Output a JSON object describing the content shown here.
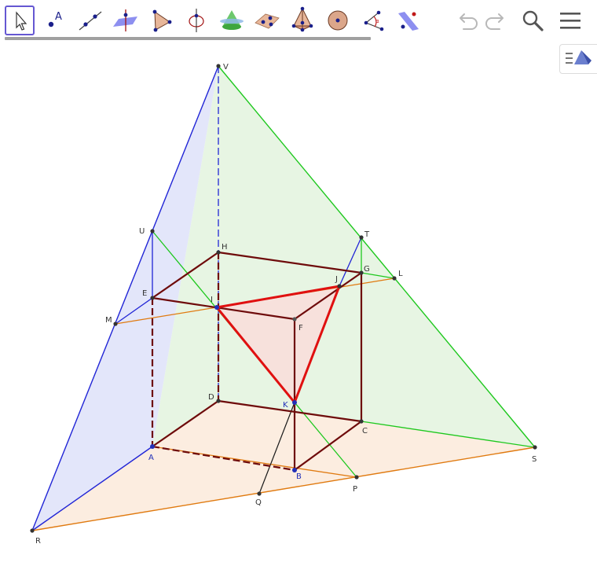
{
  "toolbar": {
    "tools": [
      {
        "name": "Move",
        "icon": "move-arrow-icon"
      },
      {
        "name": "Point",
        "icon": "point-icon",
        "glyph": "A"
      },
      {
        "name": "Line",
        "icon": "line-icon"
      },
      {
        "name": "Perpendicular Line",
        "icon": "perpendicular-line-icon"
      },
      {
        "name": "Polygon",
        "icon": "polygon-icon"
      },
      {
        "name": "Circle with Axis",
        "icon": "circle-axis-icon"
      },
      {
        "name": "Intersect Two Surfaces",
        "icon": "intersect-surfaces-icon"
      },
      {
        "name": "Plane through 3 Points",
        "icon": "plane-three-points-icon"
      },
      {
        "name": "Pyramid",
        "icon": "pyramid-icon"
      },
      {
        "name": "Sphere",
        "icon": "sphere-icon"
      },
      {
        "name": "Angle",
        "icon": "angle-icon"
      },
      {
        "name": "Reflect about Plane",
        "icon": "reflect-plane-icon"
      }
    ],
    "right_icons": [
      "undo-icon",
      "redo-icon",
      "search-icon",
      "menu-icon"
    ]
  },
  "view_toggle": {
    "icon": "graphics-view-toggle-icon"
  },
  "colors": {
    "plane_blue": "#2125d6",
    "plane_green": "#1ec81e",
    "plane_orange": "#e07a10",
    "cube_edges": "#6e0b0b",
    "section_red": "#e01010",
    "point_dark": "#333333",
    "point_blue": "#2130b8"
  },
  "points": [
    {
      "label": "V"
    },
    {
      "label": "U"
    },
    {
      "label": "M"
    },
    {
      "label": "E"
    },
    {
      "label": "H"
    },
    {
      "label": "I"
    },
    {
      "label": "T"
    },
    {
      "label": "J"
    },
    {
      "label": "G"
    },
    {
      "label": "L"
    },
    {
      "label": "F"
    },
    {
      "label": "D"
    },
    {
      "label": "K"
    },
    {
      "label": "C"
    },
    {
      "label": "A"
    },
    {
      "label": "B"
    },
    {
      "label": "P"
    },
    {
      "label": "Q"
    },
    {
      "label": "S"
    },
    {
      "label": "R"
    }
  ]
}
